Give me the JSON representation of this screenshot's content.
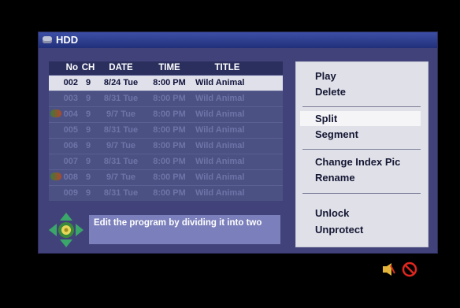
{
  "header": {
    "title": "HDD"
  },
  "columns": [
    "No",
    "CH",
    "DATE",
    "TIME",
    "TITLE"
  ],
  "rows": [
    {
      "no": "002",
      "ch": "9",
      "date": "8/24 Tue",
      "time": "8:00 PM",
      "title": "Wild Animal",
      "selected": true,
      "locked": false
    },
    {
      "no": "003",
      "ch": "9",
      "date": "8/31 Tue",
      "time": "8:00 PM",
      "title": "Wild Animal",
      "selected": false,
      "locked": false
    },
    {
      "no": "004",
      "ch": "9",
      "date": "9/7 Tue",
      "time": "8:00 PM",
      "title": "Wild Animal",
      "selected": false,
      "locked": true
    },
    {
      "no": "005",
      "ch": "9",
      "date": "8/31 Tue",
      "time": "8:00 PM",
      "title": "Wild Animal",
      "selected": false,
      "locked": false
    },
    {
      "no": "006",
      "ch": "9",
      "date": "9/7 Tue",
      "time": "8:00 PM",
      "title": "Wild Animal",
      "selected": false,
      "locked": false
    },
    {
      "no": "007",
      "ch": "9",
      "date": "8/31 Tue",
      "time": "8:00 PM",
      "title": "Wild Animal",
      "selected": false,
      "locked": false
    },
    {
      "no": "008",
      "ch": "9",
      "date": "9/7 Tue",
      "time": "8:00 PM",
      "title": "Wild Animal",
      "selected": false,
      "locked": true
    },
    {
      "no": "009",
      "ch": "9",
      "date": "8/31 Tue",
      "time": "8:00 PM",
      "title": "Wild Animal",
      "selected": false,
      "locked": false
    }
  ],
  "help": {
    "text": "Edit the program by dividing it into two"
  },
  "menu": {
    "play": "Play",
    "delete": "Delete",
    "split": "Split",
    "segment": "Segment",
    "change_index_pic": "Change Index Pic",
    "rename": "Rename",
    "unlock": "Unlock",
    "unprotect": "Unprotect"
  },
  "colors": {
    "panel": "#42427a",
    "titlebar": "#2a3a8e",
    "menu": "#e0e1e8",
    "help_box": "#7b7fbb",
    "arrow_selected": "#f2e23a"
  },
  "icons": {
    "nav": "dpad-icon",
    "audio": "audio-icon",
    "prohibited": "no-entry-icon",
    "lock": "lock-protect-icon"
  }
}
